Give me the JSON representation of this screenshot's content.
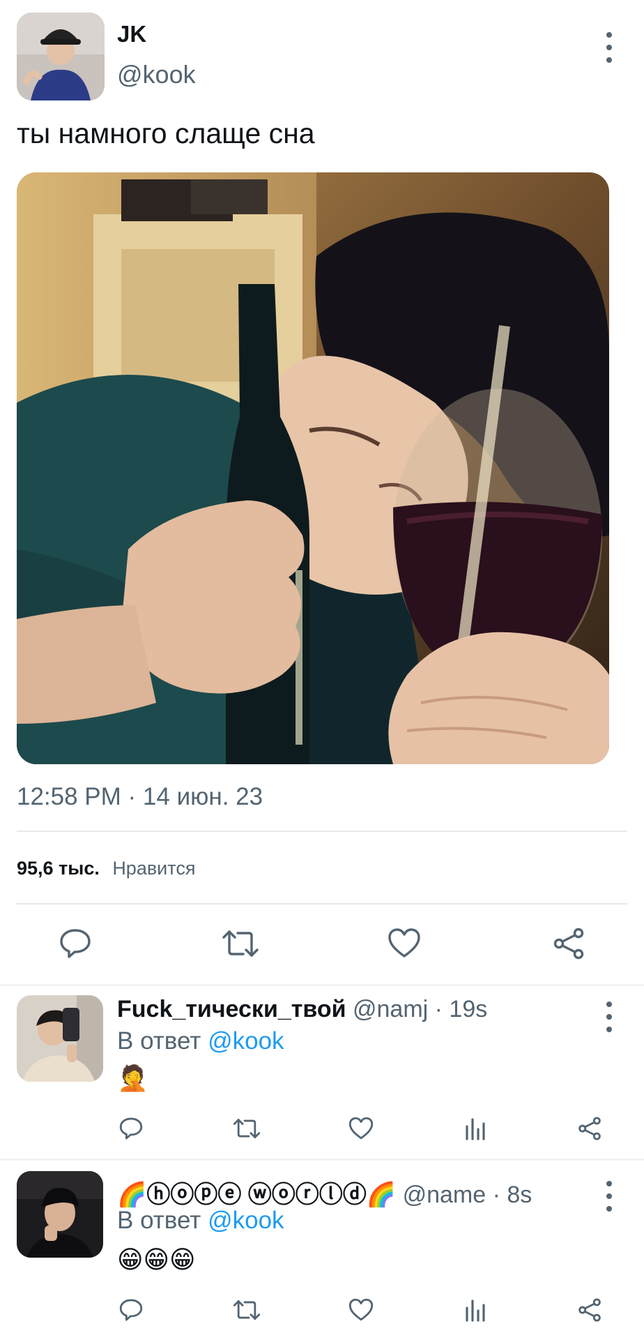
{
  "tweet": {
    "author_name": "JK",
    "author_handle": "@kook",
    "text": "ты намного слаще сна",
    "time": "12:58 PM",
    "date": "14 июн. 23",
    "likes_count": "95,6 тыс.",
    "likes_label": "Нравится"
  },
  "replies": [
    {
      "name": "Fuck_тически_твой",
      "handle": "@namj",
      "time": "19s",
      "reply_prefix": "В ответ",
      "reply_to": "@kook",
      "content": "🤦"
    },
    {
      "name": "🌈ⓗⓞⓟⓔ ⓦⓞⓡⓛⓓ🌈",
      "handle": "@name",
      "time": "8s",
      "reply_prefix": "В ответ",
      "reply_to": "@kook",
      "content": "😁😁😁"
    }
  ],
  "colors": {
    "accent": "#1d9bf0",
    "secondary_text": "#536471",
    "divider": "#e7e9ea"
  },
  "icons": [
    "more-icon",
    "reply-icon",
    "retweet-icon",
    "like-icon",
    "share-icon",
    "stats-icon"
  ]
}
